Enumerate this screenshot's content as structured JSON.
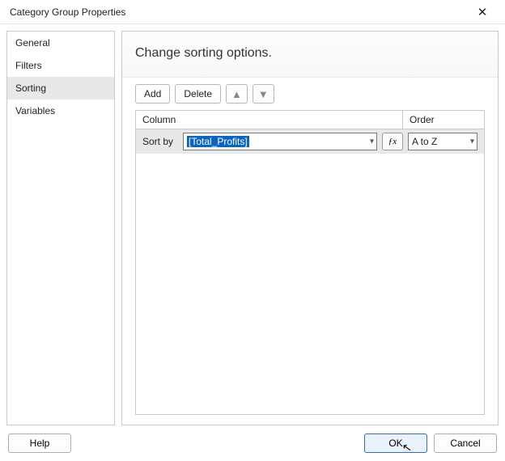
{
  "window": {
    "title": "Category Group Properties"
  },
  "sidebar": {
    "items": [
      {
        "label": "General",
        "selected": false
      },
      {
        "label": "Filters",
        "selected": false
      },
      {
        "label": "Sorting",
        "selected": true
      },
      {
        "label": "Variables",
        "selected": false
      }
    ]
  },
  "main": {
    "heading": "Change sorting options.",
    "toolbar": {
      "add_label": "Add",
      "delete_label": "Delete",
      "move_up_icon": "▲",
      "move_down_icon": "▼"
    },
    "grid": {
      "header": {
        "column": "Column",
        "order": "Order"
      },
      "row": {
        "label": "Sort by",
        "expression": "[Total_Profits]",
        "fx": "ƒx",
        "order_value": "A to Z"
      }
    }
  },
  "footer": {
    "help_label": "Help",
    "ok_label": "OK",
    "cancel_label": "Cancel"
  }
}
